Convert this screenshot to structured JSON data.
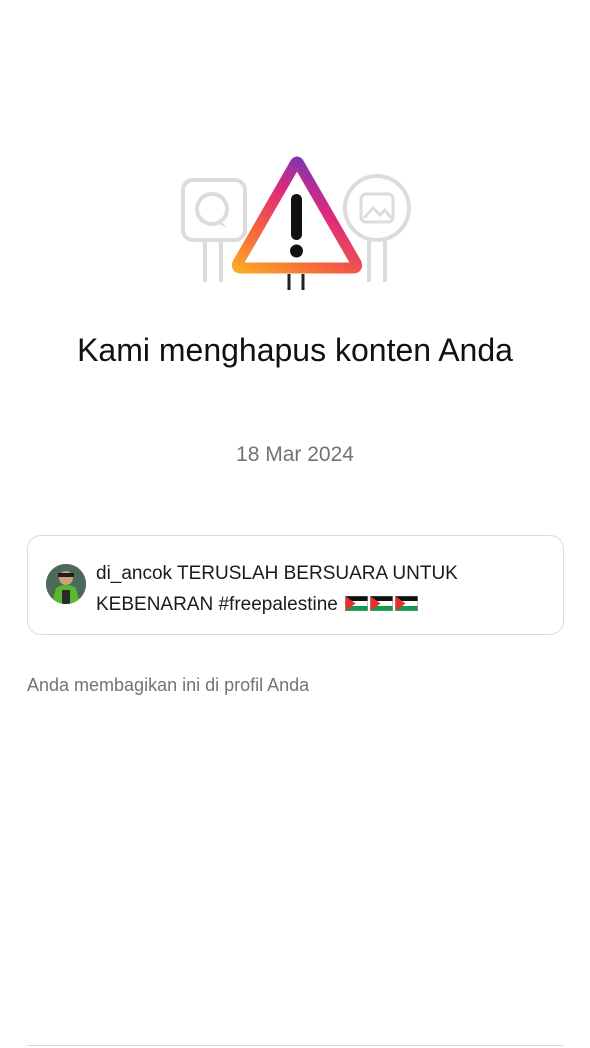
{
  "notice": {
    "headline": "Kami menghapus konten Anda",
    "date": "18 Mar 2024"
  },
  "post": {
    "username": "di_ancok",
    "caption": "TERUSLAH BERSUARA UNTUK KEBENARAN #freepalestine",
    "flag_icons": [
      "palestine-flag-icon",
      "palestine-flag-icon",
      "palestine-flag-icon"
    ]
  },
  "footer_note": "Anda membagikan ini di profil Anda",
  "icons": {
    "warning": "warning-triangle-icon",
    "comment_sign": "comment-sign-icon",
    "image_sign": "image-sign-icon"
  },
  "colors": {
    "gradient_start": "#f58529",
    "gradient_mid": "#dd2a7b",
    "gradient_end": "#8134af",
    "secondary_text": "#737373",
    "border": "#dbdbdb"
  }
}
